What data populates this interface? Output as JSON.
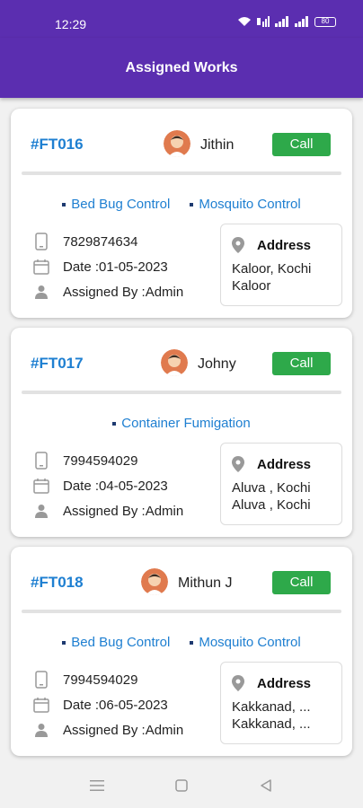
{
  "status_bar": {
    "time": "12:29",
    "battery": "80"
  },
  "appbar": {
    "title": "Assigned Works"
  },
  "works": [
    {
      "id": "#FT016",
      "name": "Jithin",
      "call_label": "Call",
      "services": [
        "Bed Bug Control",
        "Mosquito Control"
      ],
      "phone": "7829874634",
      "date": "Date :01-05-2023",
      "assigned_by": "Assigned By :Admin",
      "address_label": "Address",
      "address_line1": "Kaloor, Kochi",
      "address_line2": "Kaloor"
    },
    {
      "id": "#FT017",
      "name": "Johny",
      "call_label": "Call",
      "services": [
        "Container Fumigation"
      ],
      "phone": "7994594029",
      "date": "Date :04-05-2023",
      "assigned_by": "Assigned By :Admin",
      "address_label": "Address",
      "address_line1": "Aluva , Kochi",
      "address_line2": "Aluva , Kochi"
    },
    {
      "id": "#FT018",
      "name": "Mithun J",
      "call_label": "Call",
      "services": [
        "Bed Bug Control",
        "Mosquito Control"
      ],
      "phone": "7994594029",
      "date": "Date :06-05-2023",
      "assigned_by": "Assigned By :Admin",
      "address_label": "Address",
      "address_line1": "Kakkanad, ...",
      "address_line2": "Kakkanad, ..."
    }
  ],
  "colors": {
    "primary": "#5b2eb0",
    "link": "#1e7fd1",
    "call": "#2ea94a"
  }
}
